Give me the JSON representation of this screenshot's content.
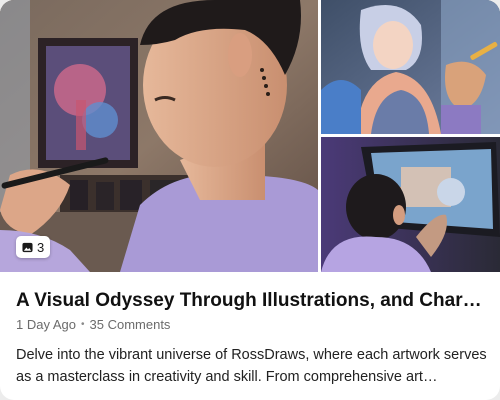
{
  "post": {
    "title": "A Visual Odyssey Through Illustrations, and Character...",
    "time_ago": "1 Day Ago",
    "comments": "35 Comments",
    "description": "Delve into the vibrant universe of RossDraws, where each artwork serves as a masterclass in creativity and skill. From comprehensive art courses...",
    "image_count": "3"
  },
  "icons": {
    "image_count_icon": "image-icon"
  },
  "colors": {
    "title": "#111111",
    "meta": "#6b6b6b",
    "description": "#222222",
    "card_background": "#ffffff"
  }
}
